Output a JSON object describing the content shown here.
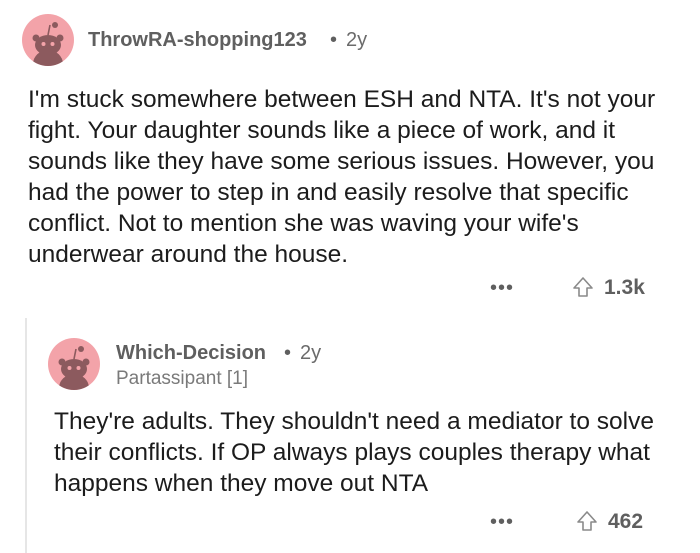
{
  "comments": [
    {
      "username": "ThrowRA-shopping123",
      "separator": "•",
      "age": "2y",
      "text": "I'm stuck somewhere between ESH and NTA. It's not your fight. Your daughter sounds like a piece of work, and it sounds like they have some serious issues. However, you had the power to step in and easily resolve that specific conflict. Not to mention she was waving your wife's underwear around the house.",
      "more_label": "•••",
      "score": "1.3k",
      "avatar_color": "#f3a3a9",
      "avatar_icon": "snoo-avatar-icon",
      "upvote_icon": "upvote-arrow-icon"
    },
    {
      "username": "Which-Decision",
      "separator": "•",
      "age": "2y",
      "flair": "Partassipant [1]",
      "text": "They're adults. They shouldn't need a mediator to solve their conflicts. If OP always plays couples therapy what happens when they move out NTA",
      "more_label": "•••",
      "score": "462",
      "avatar_color": "#f3a3a9",
      "avatar_icon": "snoo-avatar-icon",
      "upvote_icon": "upvote-arrow-icon"
    }
  ]
}
